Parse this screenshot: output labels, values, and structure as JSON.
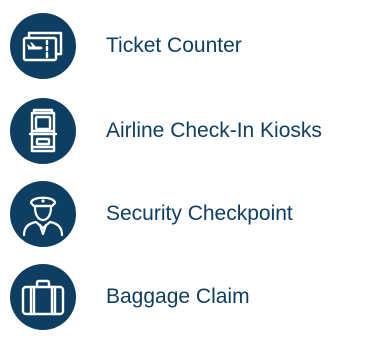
{
  "services": {
    "items": [
      {
        "label": "Ticket Counter",
        "icon": "ticket-icon"
      },
      {
        "label": "Airline Check-In Kiosks",
        "icon": "kiosk-icon"
      },
      {
        "label": "Security Checkpoint",
        "icon": "security-officer-icon"
      },
      {
        "label": "Baggage Claim",
        "icon": "suitcase-icon"
      }
    ]
  },
  "colors": {
    "icon_background": "#0e3f63",
    "icon_foreground": "#ffffff",
    "label_text": "#0e3f63"
  }
}
